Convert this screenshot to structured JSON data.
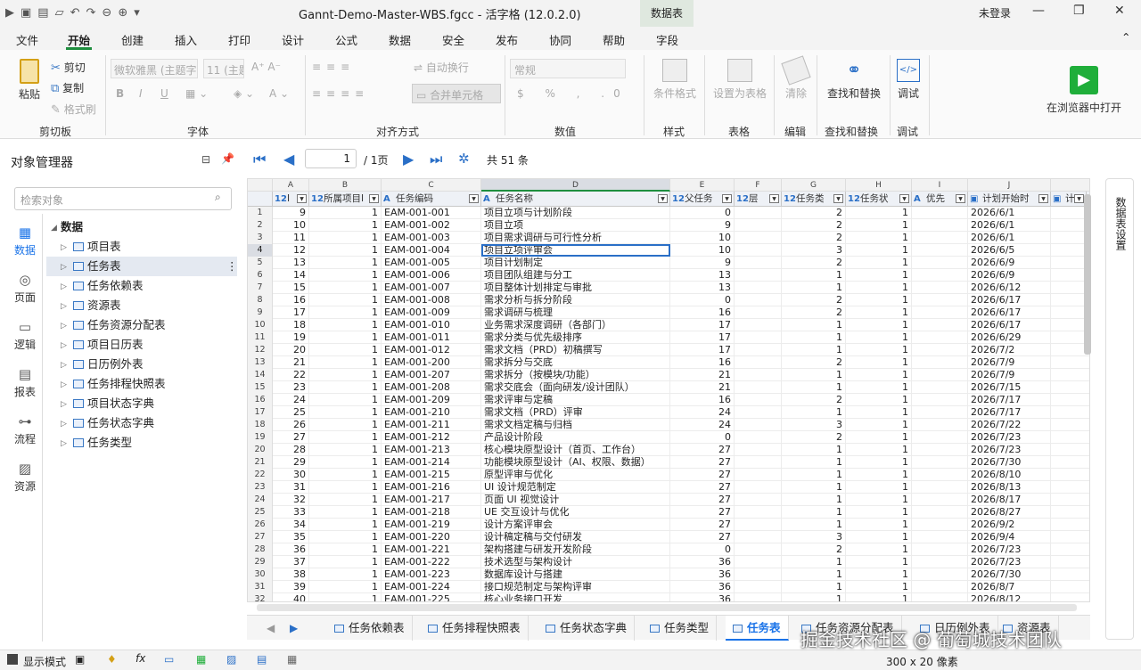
{
  "titlebar": {
    "title": "Gannt-Demo-Master-WBS.fgcc - 活字格 (12.0.2.0)",
    "context_tab_title": "数据表",
    "login": "未登录"
  },
  "menu": {
    "tabs": [
      "文件",
      "开始",
      "创建",
      "插入",
      "打印",
      "设计",
      "公式",
      "数据",
      "安全",
      "发布",
      "协同",
      "帮助",
      "字段"
    ],
    "active": "开始"
  },
  "ribbon": {
    "clipboard": {
      "paste": "粘贴",
      "cut": "剪切",
      "copy": "复制",
      "format_painter": "格式刷",
      "label": "剪切板"
    },
    "font": {
      "family": "微软雅黑 (主题字)",
      "size": "11 (主题)",
      "label": "字体"
    },
    "align": {
      "wrap": "自动换行",
      "merge": "合并单元格",
      "label": "对齐方式"
    },
    "number": {
      "format": "常规",
      "label": "数值"
    },
    "style": {
      "cond": "条件格式",
      "label": "样式"
    },
    "table": {
      "set": "设置为表格",
      "label": "表格"
    },
    "edit": {
      "clear": "清除",
      "label": "编辑"
    },
    "find": {
      "btn": "查找和替换",
      "label": "查找和替换"
    },
    "debug": {
      "btn": "调试",
      "label": "调试"
    },
    "run": {
      "btn": "在浏览器中打开"
    }
  },
  "object_manager": {
    "title": "对象管理器",
    "search_placeholder": "检索对象",
    "rail": [
      "数据",
      "页面",
      "逻辑",
      "报表",
      "流程",
      "资源"
    ],
    "tree_root": "数据",
    "tree": [
      "项目表",
      "任务表",
      "任务依赖表",
      "资源表",
      "任务资源分配表",
      "项目日历表",
      "日历例外表",
      "任务排程快照表",
      "项目状态字典",
      "任务状态字典",
      "任务类型"
    ],
    "selected": "任务表"
  },
  "pager": {
    "page": "1",
    "pages": "/ 1页",
    "total": "共 51 条"
  },
  "grid": {
    "columns": [
      "A",
      "B",
      "C",
      "D",
      "E",
      "F",
      "G",
      "H",
      "I",
      "J"
    ],
    "fields": [
      "I",
      "所属项目I",
      "任务编码",
      "任务名称",
      "父任务",
      "层",
      "任务类",
      "任务状",
      "优先",
      "计划开始时",
      "计"
    ],
    "rows": [
      [
        "9",
        "1",
        "EAM-001-001",
        "项目立项与计划阶段",
        "0",
        "",
        "2",
        "1",
        "",
        "2026/6/1"
      ],
      [
        "10",
        "1",
        "EAM-001-002",
        "项目立项",
        "9",
        "",
        "2",
        "1",
        "",
        "2026/6/1"
      ],
      [
        "11",
        "1",
        "EAM-001-003",
        "项目需求调研与可行性分析",
        "10",
        "",
        "2",
        "1",
        "",
        "2026/6/1"
      ],
      [
        "12",
        "1",
        "EAM-001-004",
        "项目立项评审会",
        "10",
        "",
        "3",
        "1",
        "",
        "2026/6/5"
      ],
      [
        "13",
        "1",
        "EAM-001-005",
        "项目计划制定",
        "9",
        "",
        "2",
        "1",
        "",
        "2026/6/9"
      ],
      [
        "14",
        "1",
        "EAM-001-006",
        "项目团队组建与分工",
        "13",
        "",
        "1",
        "1",
        "",
        "2026/6/9"
      ],
      [
        "15",
        "1",
        "EAM-001-007",
        "项目整体计划排定与审批",
        "13",
        "",
        "1",
        "1",
        "",
        "2026/6/12"
      ],
      [
        "16",
        "1",
        "EAM-001-008",
        "需求分析与拆分阶段",
        "0",
        "",
        "2",
        "1",
        "",
        "2026/6/17"
      ],
      [
        "17",
        "1",
        "EAM-001-009",
        "需求调研与梳理",
        "16",
        "",
        "2",
        "1",
        "",
        "2026/6/17"
      ],
      [
        "18",
        "1",
        "EAM-001-010",
        "业务需求深度调研（各部门）",
        "17",
        "",
        "1",
        "1",
        "",
        "2026/6/17"
      ],
      [
        "19",
        "1",
        "EAM-001-011",
        "需求分类与优先级排序",
        "17",
        "",
        "1",
        "1",
        "",
        "2026/6/29"
      ],
      [
        "20",
        "1",
        "EAM-001-012",
        "需求文档（PRD）初稿撰写",
        "17",
        "",
        "1",
        "1",
        "",
        "2026/7/2"
      ],
      [
        "21",
        "1",
        "EAM-001-200",
        "需求拆分与交底",
        "16",
        "",
        "2",
        "1",
        "",
        "2026/7/9"
      ],
      [
        "22",
        "1",
        "EAM-001-207",
        "需求拆分（按模块/功能）",
        "21",
        "",
        "1",
        "1",
        "",
        "2026/7/9"
      ],
      [
        "23",
        "1",
        "EAM-001-208",
        "需求交底会（面向研发/设计团队）",
        "21",
        "",
        "1",
        "1",
        "",
        "2026/7/15"
      ],
      [
        "24",
        "1",
        "EAM-001-209",
        "需求评审与定稿",
        "16",
        "",
        "2",
        "1",
        "",
        "2026/7/17"
      ],
      [
        "25",
        "1",
        "EAM-001-210",
        "需求文档（PRD）评审",
        "24",
        "",
        "1",
        "1",
        "",
        "2026/7/17"
      ],
      [
        "26",
        "1",
        "EAM-001-211",
        "需求文档定稿与归档",
        "24",
        "",
        "3",
        "1",
        "",
        "2026/7/22"
      ],
      [
        "27",
        "1",
        "EAM-001-212",
        "产品设计阶段",
        "0",
        "",
        "2",
        "1",
        "",
        "2026/7/23"
      ],
      [
        "28",
        "1",
        "EAM-001-213",
        "核心模块原型设计（首页、工作台）",
        "27",
        "",
        "1",
        "1",
        "",
        "2026/7/23"
      ],
      [
        "29",
        "1",
        "EAM-001-214",
        "功能模块原型设计（AI、权限、数据）",
        "27",
        "",
        "1",
        "1",
        "",
        "2026/7/30"
      ],
      [
        "30",
        "1",
        "EAM-001-215",
        "原型评审与优化",
        "27",
        "",
        "1",
        "1",
        "",
        "2026/8/10"
      ],
      [
        "31",
        "1",
        "EAM-001-216",
        "UI 设计规范制定",
        "27",
        "",
        "1",
        "1",
        "",
        "2026/8/13"
      ],
      [
        "32",
        "1",
        "EAM-001-217",
        "页面 UI 视觉设计",
        "27",
        "",
        "1",
        "1",
        "",
        "2026/8/17"
      ],
      [
        "33",
        "1",
        "EAM-001-218",
        "UE 交互设计与优化",
        "27",
        "",
        "1",
        "1",
        "",
        "2026/8/27"
      ],
      [
        "34",
        "1",
        "EAM-001-219",
        "设计方案评审会",
        "27",
        "",
        "1",
        "1",
        "",
        "2026/9/2"
      ],
      [
        "35",
        "1",
        "EAM-001-220",
        "设计稿定稿与交付研发",
        "27",
        "",
        "3",
        "1",
        "",
        "2026/9/4"
      ],
      [
        "36",
        "1",
        "EAM-001-221",
        "架构搭建与研发开发阶段",
        "0",
        "",
        "2",
        "1",
        "",
        "2026/7/23"
      ],
      [
        "37",
        "1",
        "EAM-001-222",
        "技术选型与架构设计",
        "36",
        "",
        "1",
        "1",
        "",
        "2026/7/23"
      ],
      [
        "38",
        "1",
        "EAM-001-223",
        "数据库设计与搭建",
        "36",
        "",
        "1",
        "1",
        "",
        "2026/7/30"
      ],
      [
        "39",
        "1",
        "EAM-001-224",
        "接口规范制定与架构评审",
        "36",
        "",
        "1",
        "1",
        "",
        "2026/8/7"
      ],
      [
        "40",
        "1",
        "EAM-001-225",
        "核心业务接口开发",
        "36",
        "",
        "1",
        "1",
        "",
        "2026/8/12"
      ]
    ]
  },
  "sheet_tabs": [
    "任务依赖表",
    "任务排程快照表",
    "任务状态字典",
    "任务类型",
    "任务表",
    "任务资源分配表",
    "日历例外表",
    "资源表"
  ],
  "active_sheet": "任务表",
  "right_panel": "数据表设置",
  "status": {
    "mode": "显示模式",
    "size": "300 x 20 像素"
  },
  "watermark": "掘金技术社区 @ 葡萄城技术团队"
}
